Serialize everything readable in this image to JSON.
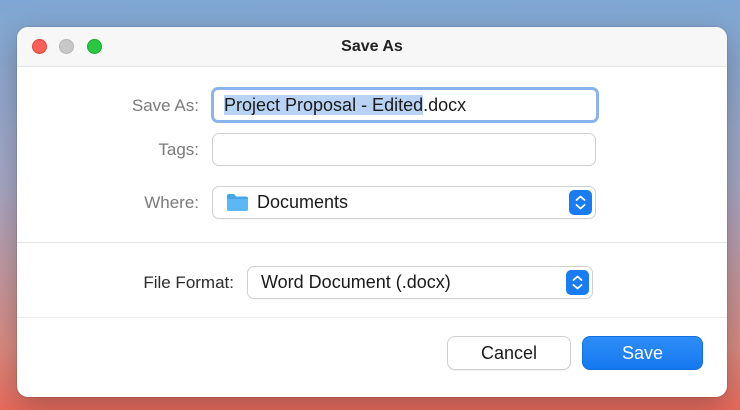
{
  "window": {
    "title": "Save As"
  },
  "form": {
    "save_as_label": "Save As:",
    "filename_selected": "Project Proposal - Edited",
    "filename_extension": ".docx",
    "tags_label": "Tags:",
    "tags_value": "",
    "where_label": "Where:",
    "where_value": "Documents",
    "file_format_label": "File Format:",
    "file_format_value": "Word Document (.docx)"
  },
  "buttons": {
    "cancel_label": "Cancel",
    "save_label": "Save"
  },
  "colors": {
    "accent": "#1a7cf2",
    "close": "#ff5f57",
    "zoom": "#28c840",
    "focus_ring": "#8ab4ee"
  },
  "icons": {
    "where": "folder-icon",
    "stepper": "chevron-up-down-icon"
  }
}
